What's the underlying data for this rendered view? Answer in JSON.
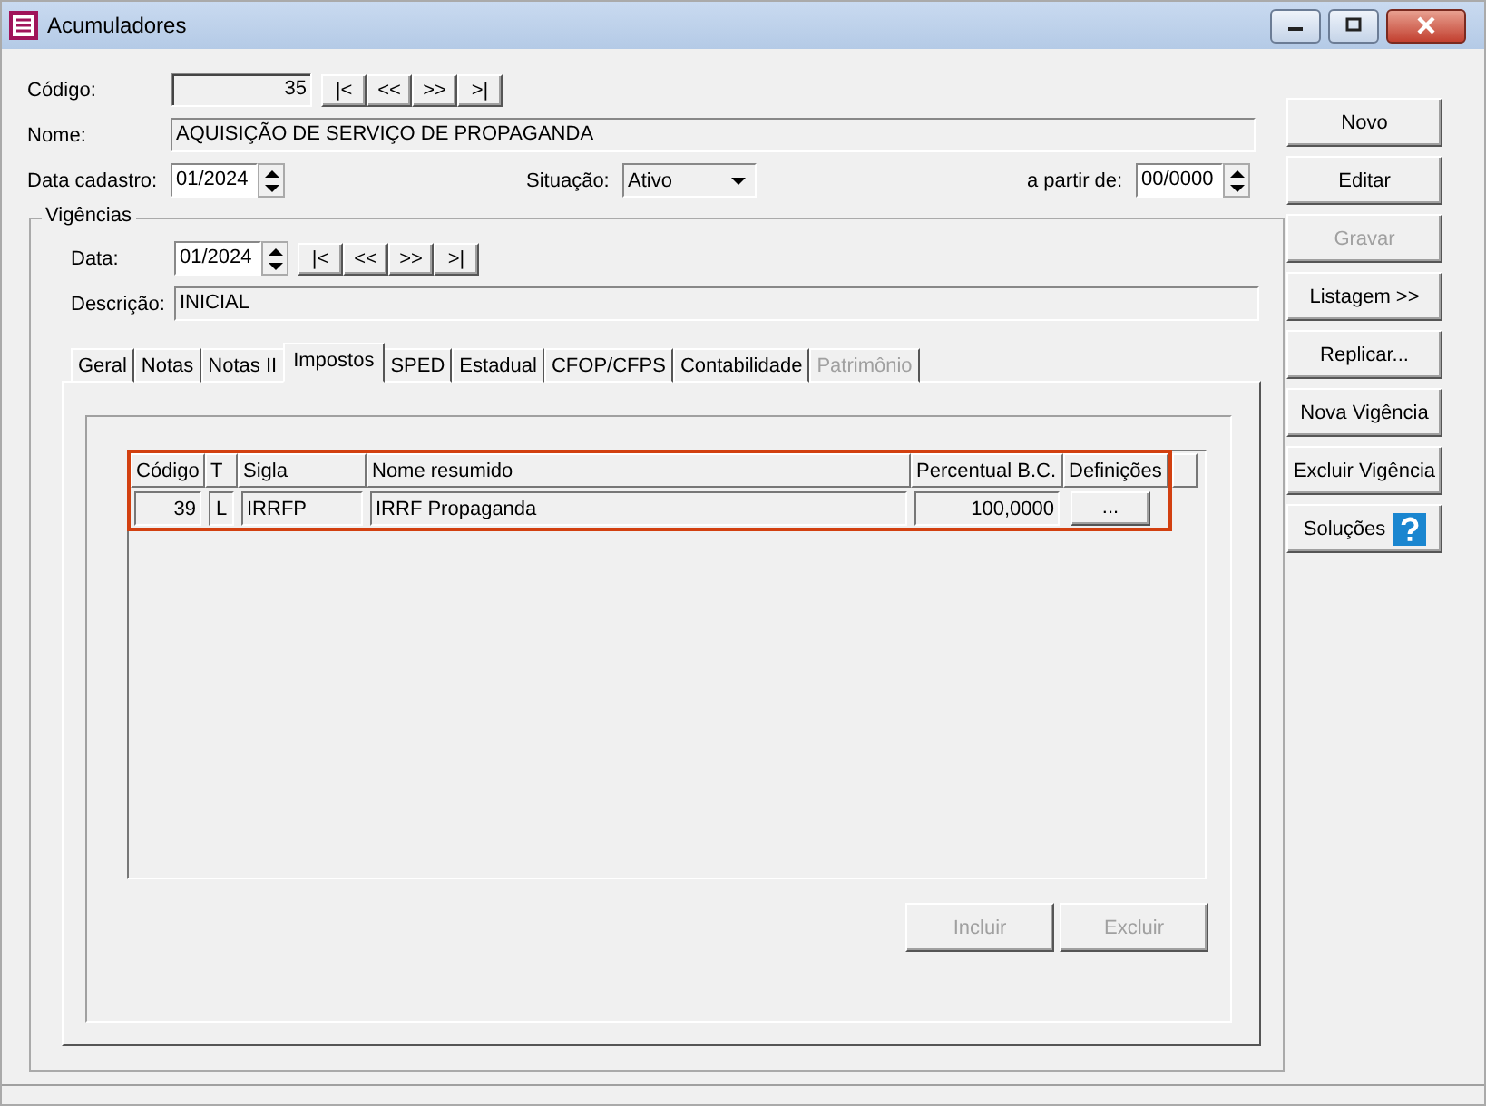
{
  "window": {
    "title": "Acumuladores"
  },
  "form": {
    "codigo": {
      "label": "Código:",
      "value": "35"
    },
    "nav_buttons": [
      "|<",
      "<<",
      ">>",
      ">|"
    ],
    "nome": {
      "label": "Nome:",
      "value": "AQUISIÇÃO DE SERVIÇO DE PROPAGANDA"
    },
    "data_cadastro": {
      "label": "Data cadastro:",
      "value": "01/2024"
    },
    "situacao": {
      "label": "Situação:",
      "value": "Ativo"
    },
    "a_partir_de": {
      "label": "a partir de:",
      "value": "00/0000"
    }
  },
  "vigencias": {
    "title": "Vigências",
    "data": {
      "label": "Data:",
      "value": "01/2024"
    },
    "nav_buttons": [
      "|<",
      "<<",
      ">>",
      ">|"
    ],
    "descricao": {
      "label": "Descrição:",
      "value": "INICIAL"
    }
  },
  "tabs": [
    {
      "label": "Geral",
      "selected": false,
      "disabled": false
    },
    {
      "label": "Notas",
      "selected": false,
      "disabled": false
    },
    {
      "label": "Notas II",
      "selected": false,
      "disabled": false
    },
    {
      "label": "Impostos",
      "selected": true,
      "disabled": false
    },
    {
      "label": "SPED",
      "selected": false,
      "disabled": false
    },
    {
      "label": "Estadual",
      "selected": false,
      "disabled": false
    },
    {
      "label": "CFOP/CFPS",
      "selected": false,
      "disabled": false
    },
    {
      "label": "Contabilidade",
      "selected": false,
      "disabled": false
    },
    {
      "label": "Patrimônio",
      "selected": false,
      "disabled": true
    }
  ],
  "table": {
    "highlighted": true,
    "columns": [
      "Código",
      "T",
      "Sigla",
      "Nome resumido",
      "Percentual B.C.",
      "Definições"
    ],
    "rows": [
      {
        "codigo": "39",
        "t": "L",
        "sigla": "IRRFP",
        "nome": "IRRF Propaganda",
        "percentual": "100,0000",
        "definicoes": "..."
      }
    ]
  },
  "table_buttons": [
    {
      "label": "Incluir",
      "disabled": true
    },
    {
      "label": "Excluir",
      "disabled": true
    }
  ],
  "side_buttons": [
    {
      "label": "Novo",
      "disabled": false,
      "kind": "plain"
    },
    {
      "label": "Editar",
      "disabled": false,
      "kind": "plain"
    },
    {
      "label": "Gravar",
      "disabled": true,
      "kind": "plain"
    },
    {
      "label": "Listagem >>",
      "disabled": false,
      "kind": "plain"
    },
    {
      "label": "Replicar...",
      "disabled": false,
      "kind": "plain"
    },
    {
      "label": "Nova Vigência",
      "disabled": false,
      "kind": "plain"
    },
    {
      "label": "Excluir Vigência",
      "disabled": false,
      "kind": "plain"
    },
    {
      "label": "Soluções",
      "disabled": false,
      "kind": "help"
    }
  ]
}
